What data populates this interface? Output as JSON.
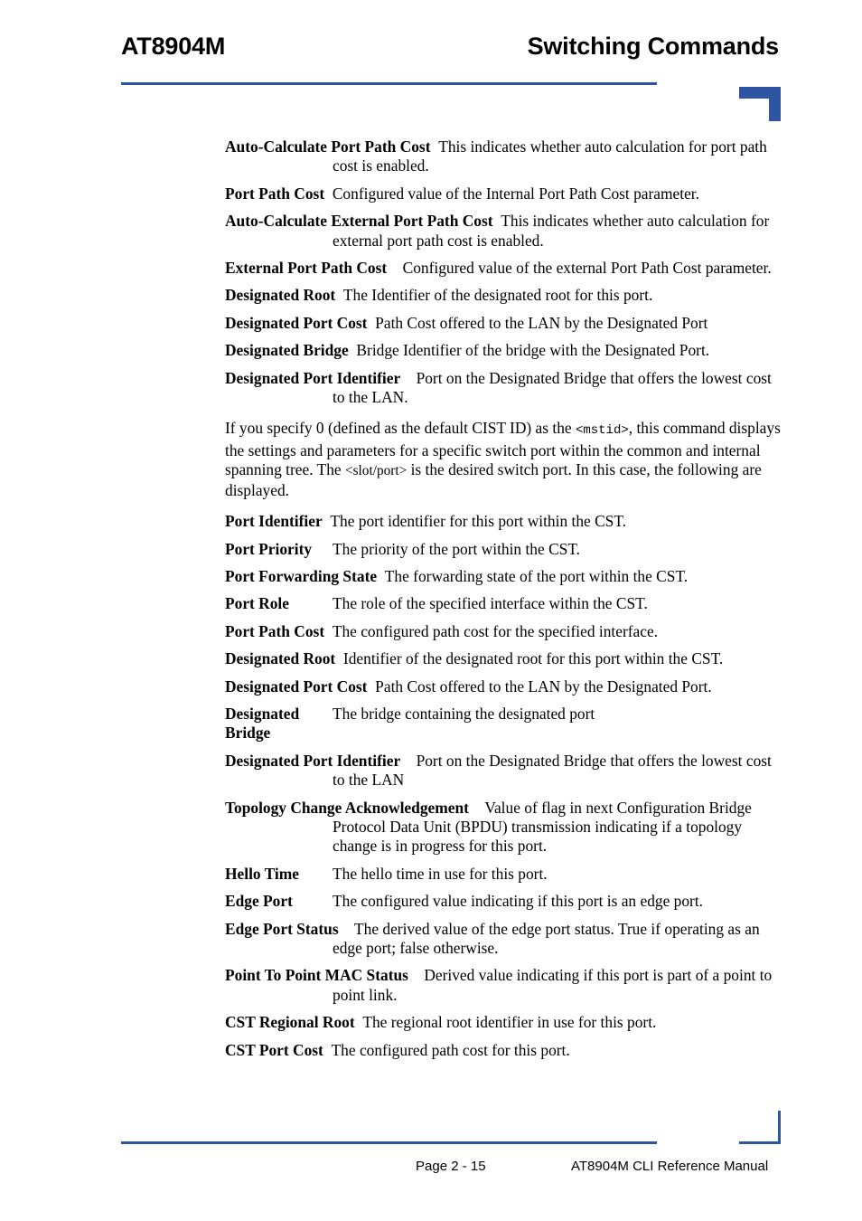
{
  "header": {
    "left_title": "AT8904M",
    "right_title": "Switching Commands",
    "accent_color": "#2e55a3"
  },
  "footer": {
    "page_label": "Page 2 - 15",
    "manual_label": "AT8904M CLI Reference Manual"
  },
  "body": {
    "definitions_group_one": [
      {
        "term": "Auto-Calculate Port Path Cost",
        "description": "This indicates whether auto calculation for port path cost is enabled."
      },
      {
        "term": "Port Path Cost",
        "description": "Configured value of the Internal Port Path Cost parameter."
      },
      {
        "term": "Auto-Calculate External Port Path Cost",
        "description": "This indicates whether auto calculation for external port path cost is enabled."
      },
      {
        "term": "External Port Path Cost",
        "description": "Configured value of the external Port Path Cost parameter."
      },
      {
        "term": "Designated Root",
        "description": "The Identifier of the designated root for this port."
      },
      {
        "term": "Designated Port Cost",
        "description": "Path Cost offered to the LAN by the Designated Port"
      },
      {
        "term": "Designated Bridge",
        "description": "Bridge Identifier of the bridge with the Designated Port."
      },
      {
        "term": "Designated Port Identifier",
        "description": "Port on the Designated Bridge that offers the lowest cost to the LAN."
      }
    ],
    "paragraph": {
      "part1": "If you specify 0 (defined as the default CIST ID) as the ",
      "mono_token": "<mstid>",
      "part2": ", this command displays the settings and parameters for a specific switch port within the common and internal spanning tree. The ",
      "angle_token": "<slot/port>",
      "part3": " is the desired switch port. In this case, the following are displayed."
    },
    "definitions_group_two": [
      {
        "term": "Port Identifier",
        "description": "The port identifier for this port within the CST."
      },
      {
        "term": "Port Priority",
        "description": "The priority of the port within the CST."
      },
      {
        "term": "Port Forwarding State",
        "description": "The forwarding state of the port within the CST."
      },
      {
        "term": "Port Role",
        "description": "The role of the specified interface within the CST."
      },
      {
        "term": "Port Path Cost",
        "description": "The configured path cost for the specified interface."
      },
      {
        "term": "Designated Root",
        "description": "Identifier of the designated root for this port within the CST."
      },
      {
        "term": "Designated Port Cost",
        "description": "Path Cost offered to the LAN by the Designated Port."
      },
      {
        "term": "Designated Bridge",
        "description": "The bridge containing the designated port"
      },
      {
        "term": "Designated Port Identifier",
        "description": "Port on the Designated Bridge that offers the lowest cost to the LAN"
      },
      {
        "term": "Topology Change Acknowledgement",
        "description": "Value of flag in next Configuration Bridge Protocol Data Unit (BPDU) transmission indicating if a topology change is in progress for this port."
      },
      {
        "term": "Hello Time",
        "description": "The hello time in use for this port."
      },
      {
        "term": "Edge Port",
        "description": "The configured value indicating if this port is an edge port."
      },
      {
        "term": "Edge Port Status",
        "description": "The derived value of the edge port status. True if operating as an edge port; false otherwise."
      },
      {
        "term": "Point To Point MAC Status",
        "description": "Derived value indicating if this port is part of a point to point link."
      },
      {
        "term": "CST Regional Root",
        "description": "The regional root identifier in use for this port."
      },
      {
        "term": "CST Port Cost",
        "description": "The configured path cost for this port."
      }
    ]
  }
}
